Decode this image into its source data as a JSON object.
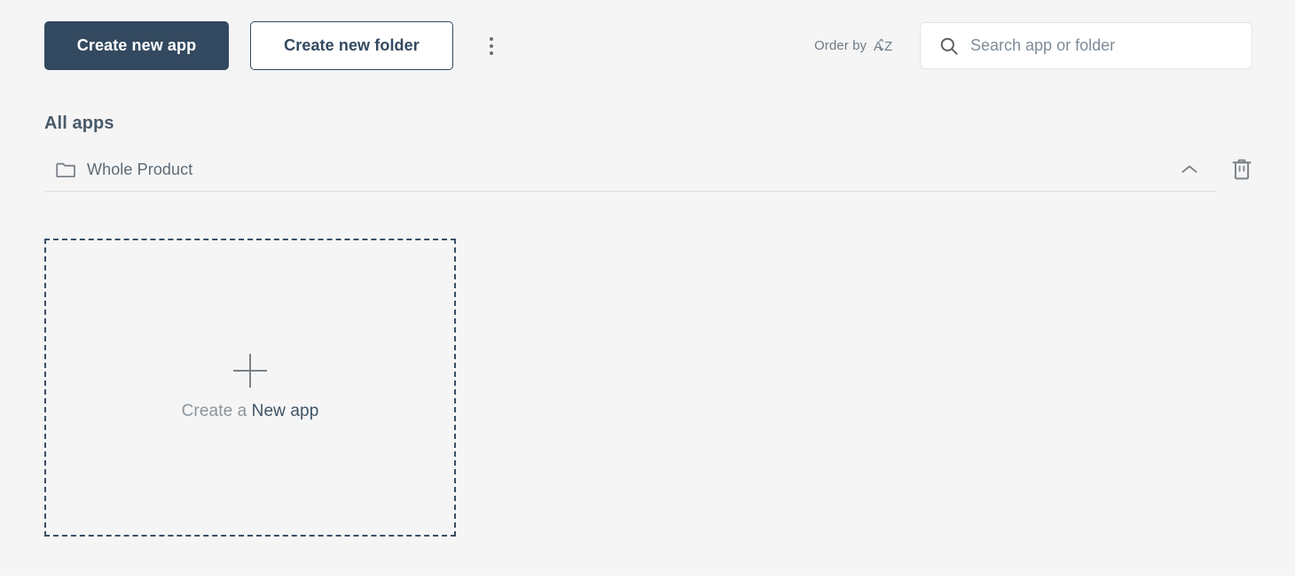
{
  "theme": {
    "page_bg": "#f5f5f6",
    "primary": "#33495f",
    "text_muted": "#6f7b84",
    "border_light": "#e2e4e6",
    "divider": "#d9dcde",
    "dashed_border": "#3a4f66"
  },
  "toolbar": {
    "create_app_label": "Create new app",
    "create_folder_label": "Create new folder",
    "more_menu_icon": "kebab-menu-icon",
    "order_by_label": "Order by",
    "order_by_icon": "sort-alpha-az-icon",
    "search": {
      "icon": "search-icon",
      "placeholder": "Search app or folder",
      "value": ""
    }
  },
  "main": {
    "section_title": "All apps",
    "folders": [
      {
        "icon": "folder-icon",
        "name": "Whole Product",
        "collapse_icon": "chevron-up-icon",
        "delete_icon": "trash-icon",
        "expanded": true
      }
    ],
    "new_app_card": {
      "plus_icon": "plus-icon",
      "caption_prefix": "Create a ",
      "caption_emphasis": "New app"
    }
  }
}
